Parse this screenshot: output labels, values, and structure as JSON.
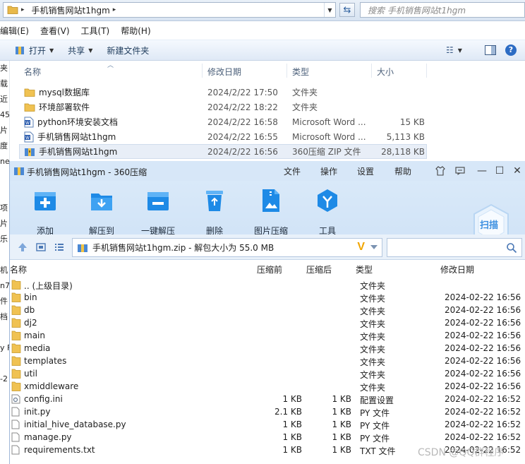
{
  "explorer": {
    "breadcrumb": "手机销售网站t1hgm",
    "search_placeholder": "搜索 手机销售网站t1hgm",
    "menu": [
      "编辑(E)",
      "查看(V)",
      "工具(T)",
      "帮助(H)"
    ],
    "toolbar": {
      "open": "打开",
      "share": "共享",
      "new_folder": "新建文件夹"
    },
    "left_nav": [
      "夹",
      "载",
      "近",
      "45",
      "片",
      "度",
      "nel",
      "",
      "",
      "项",
      "片",
      "乐",
      "",
      "机",
      "n7",
      "件",
      "档",
      "",
      "y F",
      "",
      "-2"
    ],
    "columns": {
      "name": "名称",
      "modified": "修改日期",
      "type": "类型",
      "size": "大小"
    },
    "rows": [
      {
        "icon": "folder-icon",
        "name": "mysql数据库",
        "modified": "2024/2/22 17:50",
        "type": "文件夹",
        "size": ""
      },
      {
        "icon": "folder-icon",
        "name": "环境部署软件",
        "modified": "2024/2/22 18:22",
        "type": "文件夹",
        "size": ""
      },
      {
        "icon": "word-doc-icon",
        "name": "python环境安装文档",
        "modified": "2024/2/22 16:58",
        "type": "Microsoft Word ...",
        "size": "15 KB"
      },
      {
        "icon": "word-doc-icon",
        "name": "手机销售网站t1hgm",
        "modified": "2024/2/22 16:55",
        "type": "Microsoft Word ...",
        "size": "5,113 KB"
      },
      {
        "icon": "zip-archive-icon",
        "name": "手机销售网站t1hgm",
        "modified": "2024/2/22 16:56",
        "type": "360压缩 ZIP 文件",
        "size": "28,118 KB"
      }
    ]
  },
  "zip": {
    "title": "手机销售网站t1hgm - 360压缩",
    "menu": [
      "文件",
      "操作",
      "设置",
      "帮助"
    ],
    "ribbon": [
      "添加",
      "解压到",
      "一键解压",
      "删除",
      "图片压缩",
      "工具"
    ],
    "scan_label": "扫描",
    "path": "手机销售网站t1hgm.zip - 解包大小为 55.0 MB",
    "columns": {
      "name": "名称",
      "compressed_before": "压缩前",
      "compressed_after": "压缩后",
      "type": "类型",
      "modified": "修改日期"
    },
    "rows": [
      {
        "icon": "folder-icon",
        "name": ".. (上级目录)",
        "before": "",
        "after": "",
        "type": "文件夹",
        "modified": ""
      },
      {
        "icon": "folder-icon",
        "name": "bin",
        "before": "",
        "after": "",
        "type": "文件夹",
        "modified": "2024-02-22 16:56"
      },
      {
        "icon": "folder-icon",
        "name": "db",
        "before": "",
        "after": "",
        "type": "文件夹",
        "modified": "2024-02-22 16:56"
      },
      {
        "icon": "folder-icon",
        "name": "dj2",
        "before": "",
        "after": "",
        "type": "文件夹",
        "modified": "2024-02-22 16:56"
      },
      {
        "icon": "folder-icon",
        "name": "main",
        "before": "",
        "after": "",
        "type": "文件夹",
        "modified": "2024-02-22 16:56"
      },
      {
        "icon": "folder-icon",
        "name": "media",
        "before": "",
        "after": "",
        "type": "文件夹",
        "modified": "2024-02-22 16:56"
      },
      {
        "icon": "folder-icon",
        "name": "templates",
        "before": "",
        "after": "",
        "type": "文件夹",
        "modified": "2024-02-22 16:56"
      },
      {
        "icon": "folder-icon",
        "name": "util",
        "before": "",
        "after": "",
        "type": "文件夹",
        "modified": "2024-02-22 16:56"
      },
      {
        "icon": "folder-icon",
        "name": "xmiddleware",
        "before": "",
        "after": "",
        "type": "文件夹",
        "modified": "2024-02-22 16:56"
      },
      {
        "icon": "settings-file-icon",
        "name": "config.ini",
        "before": "1 KB",
        "after": "1 KB",
        "type": "配置设置",
        "modified": "2024-02-22 16:52"
      },
      {
        "icon": "file-icon",
        "name": "init.py",
        "before": "2.1 KB",
        "after": "1 KB",
        "type": "PY 文件",
        "modified": "2024-02-22 16:52"
      },
      {
        "icon": "file-icon",
        "name": "initial_hive_database.py",
        "before": "1 KB",
        "after": "1 KB",
        "type": "PY 文件",
        "modified": "2024-02-22 16:52"
      },
      {
        "icon": "file-icon",
        "name": "manage.py",
        "before": "1 KB",
        "after": "1 KB",
        "type": "PY 文件",
        "modified": "2024-02-22 16:52"
      },
      {
        "icon": "file-icon",
        "name": "requirements.txt",
        "before": "1 KB",
        "after": "1 KB",
        "type": "TXT 文件",
        "modified": "2024-02-22 16:52"
      }
    ]
  },
  "watermark": "CSDN @QQ群程序"
}
